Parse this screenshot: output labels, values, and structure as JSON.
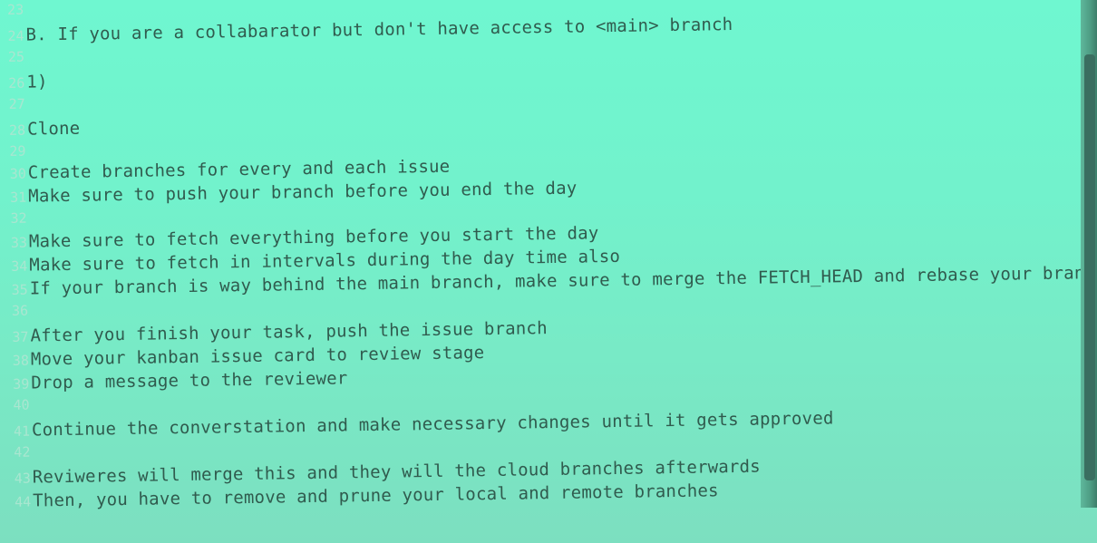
{
  "editor": {
    "lines": [
      {
        "num": "23",
        "text": ""
      },
      {
        "num": "24",
        "text": "B. If you are a collabarator but don't have access to <main> branch"
      },
      {
        "num": "25",
        "text": ""
      },
      {
        "num": "26",
        "text": "1)"
      },
      {
        "num": "27",
        "text": ""
      },
      {
        "num": "28",
        "text": "Clone"
      },
      {
        "num": "29",
        "text": ""
      },
      {
        "num": "30",
        "text": "Create branches for every and each issue"
      },
      {
        "num": "31",
        "text": "Make sure to push your branch before you end the day"
      },
      {
        "num": "32",
        "text": ""
      },
      {
        "num": "33",
        "text": "Make sure to fetch everything before you start the day"
      },
      {
        "num": "34",
        "text": "Make sure to fetch in intervals during the day time also"
      },
      {
        "num": "35",
        "text": "If your branch is way behind the main branch, make sure to merge the FETCH_HEAD and rebase your branch"
      },
      {
        "num": "36",
        "text": ""
      },
      {
        "num": "37",
        "text": "After you finish your task, push the issue branch"
      },
      {
        "num": "38",
        "text": "Move your kanban issue card to review stage"
      },
      {
        "num": "39",
        "text": "Drop a message to the reviewer"
      },
      {
        "num": "40",
        "text": ""
      },
      {
        "num": "41",
        "text": "Continue the converstation and make necessary changes until it gets approved"
      },
      {
        "num": "42",
        "text": ""
      },
      {
        "num": "43",
        "text": "Reviweres will merge this and they will the cloud branches afterwards"
      },
      {
        "num": "44",
        "text": "Then, you have to remove and prune your local and remote branches"
      }
    ]
  }
}
